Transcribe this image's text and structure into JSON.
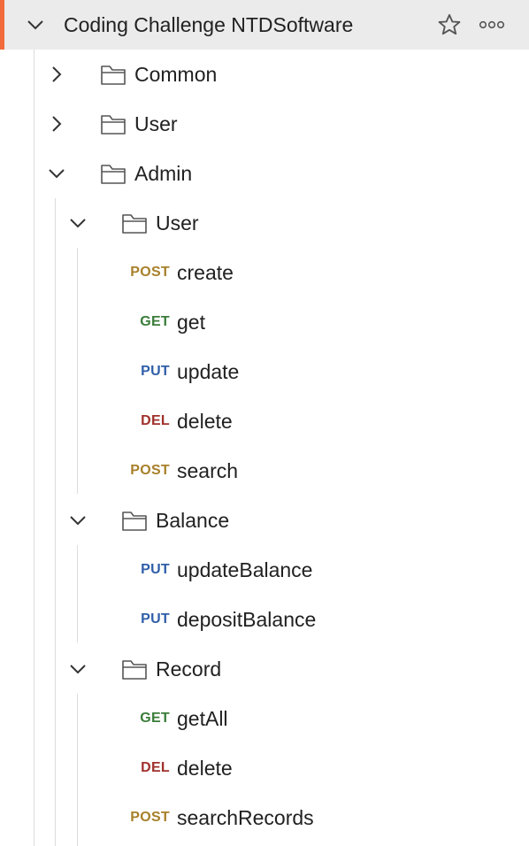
{
  "collection": {
    "title": "Coding Challenge NTDSoftware",
    "accent_color": "#f26b3a",
    "actions": [
      "star-icon",
      "more-options-icon"
    ]
  },
  "folders": {
    "common": "Common",
    "user": "User",
    "admin": "Admin",
    "admin_user": "User",
    "admin_balance": "Balance",
    "admin_record": "Record"
  },
  "method_colors": {
    "POST": "#a8802a",
    "GET": "#3a7d3a",
    "PUT": "#2f5ea8",
    "DEL": "#a0302c"
  },
  "requests": {
    "user_create": {
      "method": "POST",
      "name": "create"
    },
    "user_get": {
      "method": "GET",
      "name": "get"
    },
    "user_update": {
      "method": "PUT",
      "name": "update"
    },
    "user_delete": {
      "method": "DEL",
      "name": "delete"
    },
    "user_search": {
      "method": "POST",
      "name": "search"
    },
    "balance_update": {
      "method": "PUT",
      "name": "updateBalance"
    },
    "balance_deposit": {
      "method": "PUT",
      "name": "depositBalance"
    },
    "record_getall": {
      "method": "GET",
      "name": "getAll"
    },
    "record_delete": {
      "method": "DEL",
      "name": "delete"
    },
    "record_search": {
      "method": "POST",
      "name": "searchRecords"
    }
  }
}
